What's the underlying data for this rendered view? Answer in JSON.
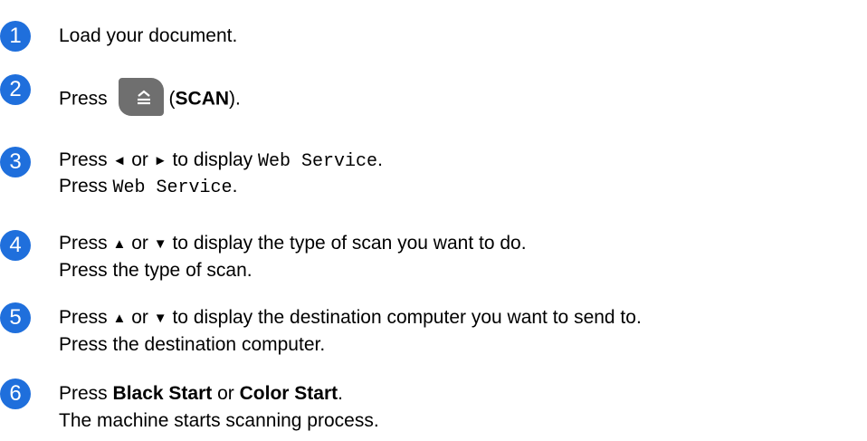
{
  "steps": [
    {
      "number": "1",
      "text": "Load your document."
    },
    {
      "number": "2",
      "press": "Press",
      "button_name": "SCAN",
      "paren_open": "(",
      "paren_close": ")."
    },
    {
      "number": "3",
      "press1": "Press",
      "left_arrow": "◄",
      "or": "or",
      "right_arrow": "►",
      "to_display": "to display",
      "code": "Web Service",
      "period1": ".",
      "press2": "Press",
      "code2": "Web Service",
      "period2": "."
    },
    {
      "number": "4",
      "press1": "Press",
      "up_arrow": "▲",
      "or": "or",
      "down_arrow": "▼",
      "rest1": "to display the type of scan you want to do.",
      "line2": "Press the type of scan."
    },
    {
      "number": "5",
      "press1": "Press",
      "up_arrow": "▲",
      "or": "or",
      "down_arrow": "▼",
      "rest1": "to display the destination computer you want to send to.",
      "line2": "Press the destination computer."
    },
    {
      "number": "6",
      "press1": "Press",
      "black_start": "Black Start",
      "or": "or",
      "color_start": "Color Start",
      "period": ".",
      "line2": "The machine starts scanning process."
    }
  ],
  "colors": {
    "badge": "#1f6fdc",
    "scan_button": "#6f6f6f"
  },
  "icons": {
    "scan_button_icon": "scan-icon"
  }
}
